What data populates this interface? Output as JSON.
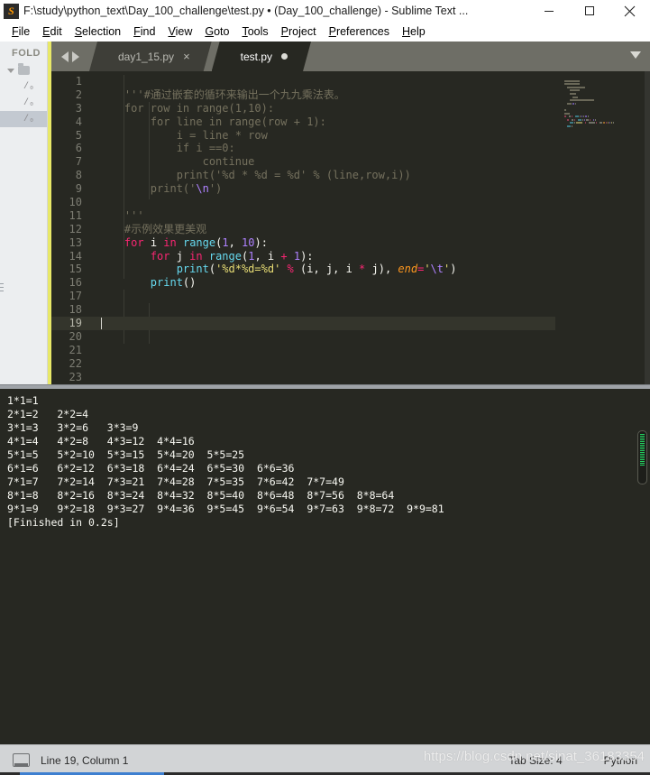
{
  "window": {
    "title": "F:\\study\\python_text\\Day_100_challenge\\test.py • (Day_100_challenge) - Sublime Text ...",
    "logo_glyph": "S",
    "controls": {
      "minimize": "minimize-icon",
      "maximize": "maximize-icon",
      "close": "close-icon"
    }
  },
  "menubar": {
    "items": [
      {
        "label": "File"
      },
      {
        "label": "Edit"
      },
      {
        "label": "Selection"
      },
      {
        "label": "Find"
      },
      {
        "label": "View"
      },
      {
        "label": "Goto"
      },
      {
        "label": "Tools"
      },
      {
        "label": "Project"
      },
      {
        "label": "Preferences"
      },
      {
        "label": "Help"
      }
    ]
  },
  "sidebar": {
    "header": "FOLD",
    "folder_row": "",
    "files": [
      "/₀",
      "/₀",
      "/₀"
    ],
    "selected_index": 2
  },
  "tabs": {
    "items": [
      {
        "label": "day1_15.py",
        "active": false,
        "dirty": false,
        "close_glyph": "×"
      },
      {
        "label": "test.py",
        "active": true,
        "dirty": true,
        "close_glyph": ""
      }
    ],
    "nav_back": "nav-back-arrow",
    "nav_forward": "nav-forward-arrow",
    "menu_chevron": "chevron-down-icon"
  },
  "editor": {
    "total_lines": 23,
    "active_line": 19,
    "lines": [
      {
        "n": 1,
        "tokens": []
      },
      {
        "n": 2,
        "tokens": [
          {
            "t": "com",
            "v": "    '''#通过嵌套的循环来输出一个九九乘法表。"
          }
        ]
      },
      {
        "n": 3,
        "tokens": [
          {
            "t": "com",
            "v": "    for row in range(1,10):"
          }
        ]
      },
      {
        "n": 4,
        "tokens": [
          {
            "t": "com",
            "v": "        for line in range(row + 1):"
          }
        ]
      },
      {
        "n": 5,
        "tokens": [
          {
            "t": "com",
            "v": "            i = line * row"
          }
        ]
      },
      {
        "n": 6,
        "tokens": [
          {
            "t": "com",
            "v": "            if i ==0:"
          }
        ]
      },
      {
        "n": 7,
        "tokens": [
          {
            "t": "com",
            "v": "                continue"
          }
        ]
      },
      {
        "n": 8,
        "tokens": [
          {
            "t": "com",
            "v": "            print('%d * %d = %d' % (line,row,i))"
          }
        ]
      },
      {
        "n": 9,
        "tokens": [
          {
            "t": "com",
            "v": "        print('"
          },
          {
            "t": "esc",
            "v": "\\n"
          },
          {
            "t": "com",
            "v": "')"
          }
        ]
      },
      {
        "n": 10,
        "tokens": []
      },
      {
        "n": 11,
        "tokens": [
          {
            "t": "com",
            "v": "    '''"
          }
        ]
      },
      {
        "n": 12,
        "tokens": [
          {
            "t": "com",
            "v": "    #示例效果更美观"
          }
        ]
      },
      {
        "n": 13,
        "tokens": [
          {
            "t": "plain",
            "v": "    "
          },
          {
            "t": "kw",
            "v": "for"
          },
          {
            "t": "plain",
            "v": " i "
          },
          {
            "t": "kw",
            "v": "in"
          },
          {
            "t": "plain",
            "v": " "
          },
          {
            "t": "fn",
            "v": "range"
          },
          {
            "t": "par",
            "v": "("
          },
          {
            "t": "num",
            "v": "1"
          },
          {
            "t": "par",
            "v": ", "
          },
          {
            "t": "num",
            "v": "10"
          },
          {
            "t": "par",
            "v": "):"
          }
        ]
      },
      {
        "n": 14,
        "tokens": [
          {
            "t": "plain",
            "v": "        "
          },
          {
            "t": "kw",
            "v": "for"
          },
          {
            "t": "plain",
            "v": " j "
          },
          {
            "t": "kw",
            "v": "in"
          },
          {
            "t": "plain",
            "v": " "
          },
          {
            "t": "fn",
            "v": "range"
          },
          {
            "t": "par",
            "v": "("
          },
          {
            "t": "num",
            "v": "1"
          },
          {
            "t": "par",
            "v": ", i "
          },
          {
            "t": "op",
            "v": "+"
          },
          {
            "t": "par",
            "v": " "
          },
          {
            "t": "num",
            "v": "1"
          },
          {
            "t": "par",
            "v": "):"
          }
        ]
      },
      {
        "n": 15,
        "tokens": [
          {
            "t": "plain",
            "v": "            "
          },
          {
            "t": "fn",
            "v": "print"
          },
          {
            "t": "par",
            "v": "("
          },
          {
            "t": "str",
            "v": "'%d*%d=%d'"
          },
          {
            "t": "plain",
            "v": " "
          },
          {
            "t": "op",
            "v": "%"
          },
          {
            "t": "par",
            "v": " (i, j, i "
          },
          {
            "t": "op",
            "v": "*"
          },
          {
            "t": "par",
            "v": " j), "
          },
          {
            "t": "var",
            "v": "end"
          },
          {
            "t": "op",
            "v": "="
          },
          {
            "t": "str",
            "v": "'"
          },
          {
            "t": "esc",
            "v": "\\t"
          },
          {
            "t": "str",
            "v": "'"
          },
          {
            "t": "par",
            "v": ")"
          }
        ]
      },
      {
        "n": 16,
        "tokens": [
          {
            "t": "plain",
            "v": "        "
          },
          {
            "t": "fn",
            "v": "print"
          },
          {
            "t": "par",
            "v": "()"
          }
        ]
      },
      {
        "n": 17,
        "tokens": []
      },
      {
        "n": 18,
        "tokens": []
      },
      {
        "n": 19,
        "tokens": []
      },
      {
        "n": 20,
        "tokens": []
      },
      {
        "n": 21,
        "tokens": []
      },
      {
        "n": 22,
        "tokens": []
      },
      {
        "n": 23,
        "tokens": []
      }
    ]
  },
  "output": {
    "lines": [
      "1*1=1",
      "2*1=2   2*2=4",
      "3*1=3   3*2=6   3*3=9",
      "4*1=4   4*2=8   4*3=12  4*4=16",
      "5*1=5   5*2=10  5*3=15  5*4=20  5*5=25",
      "6*1=6   6*2=12  6*3=18  6*4=24  6*5=30  6*6=36",
      "7*1=7   7*2=14  7*3=21  7*4=28  7*5=35  7*6=42  7*7=49",
      "8*1=8   8*2=16  8*3=24  8*4=32  8*5=40  8*6=48  8*7=56  8*8=64",
      "9*1=9   9*2=18  9*3=27  9*4=36  9*5=45  9*6=54  9*7=63  9*8=72  9*9=81",
      "[Finished in 0.2s]"
    ]
  },
  "statusbar": {
    "position": "Line 19, Column 1",
    "tab_size": "Tab Size: 4",
    "syntax": "Python",
    "watermark": "https://blog.csdn.net/sinat_36183354"
  },
  "colors": {
    "editor_bg": "#272822",
    "comment": "#75715e",
    "keyword": "#f92672",
    "function": "#66d9ef",
    "number": "#ae81ff",
    "string": "#e6db74",
    "variable": "#fd971f",
    "accent_strip": "#e8e868",
    "scroll_thumb": "#23d160"
  }
}
